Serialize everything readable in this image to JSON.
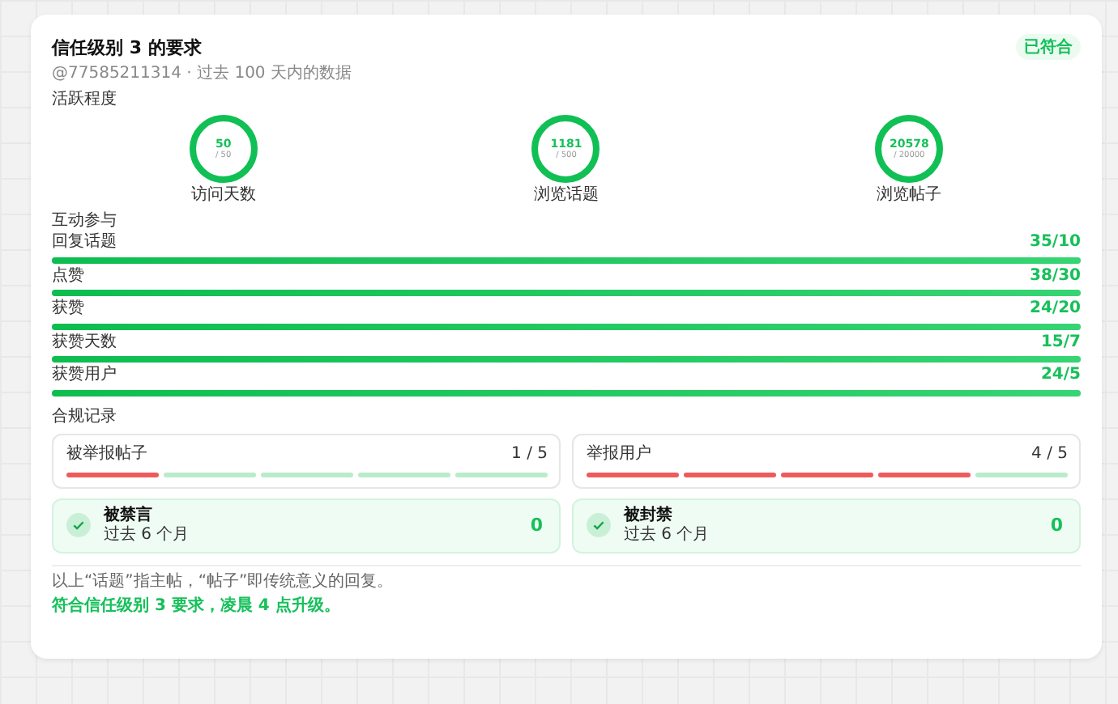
{
  "header": {
    "title": "信任级别 3 的要求",
    "badge": "已符合",
    "subtitle": "@77585211314 · 过去 100 天内的数据"
  },
  "activity": {
    "title": "活跃程度",
    "rings": [
      {
        "value": "50",
        "target": "/ 50",
        "label": "访问天数",
        "level": 1
      },
      {
        "value": "1181",
        "target": "/ 500",
        "label": "浏览话题",
        "level": 1
      },
      {
        "value": "20578",
        "target": "/ 20000",
        "label": "浏览帖子",
        "level": 1
      }
    ]
  },
  "engagement": {
    "title": "互动参与",
    "bars": [
      {
        "label": "回复话题",
        "reading": "35/10",
        "level": 1
      },
      {
        "label": "点赞",
        "reading": "38/30",
        "level": 1
      },
      {
        "label": "获赞",
        "reading": "24/20",
        "level": 1
      },
      {
        "label": "获赞天数",
        "reading": "15/7",
        "level": 1
      },
      {
        "label": "获赞用户",
        "reading": "24/5",
        "level": 1
      }
    ]
  },
  "compliance": {
    "title": "合规记录",
    "counters": [
      {
        "label": "被举报帖子",
        "reading": "1 / 5",
        "segments": [
          {
            "flagged": true
          },
          {
            "flagged": false
          },
          {
            "flagged": false
          },
          {
            "flagged": false
          },
          {
            "flagged": false
          }
        ]
      },
      {
        "label": "举报用户",
        "reading": "4 / 5",
        "segments": [
          {
            "flagged": true
          },
          {
            "flagged": true
          },
          {
            "flagged": true
          },
          {
            "flagged": true
          },
          {
            "flagged": false
          }
        ]
      }
    ],
    "penalties": [
      {
        "title": "被禁言",
        "period": "过去 6 个月",
        "count": "0"
      },
      {
        "title": "被封禁",
        "period": "过去 6 个月",
        "count": "0"
      }
    ]
  },
  "footer": {
    "note": "以上“话题”指主帖，“帖子”即传统意义的回复。",
    "result": "符合信任级别 3 要求，凌晨 4 点升级。"
  }
}
